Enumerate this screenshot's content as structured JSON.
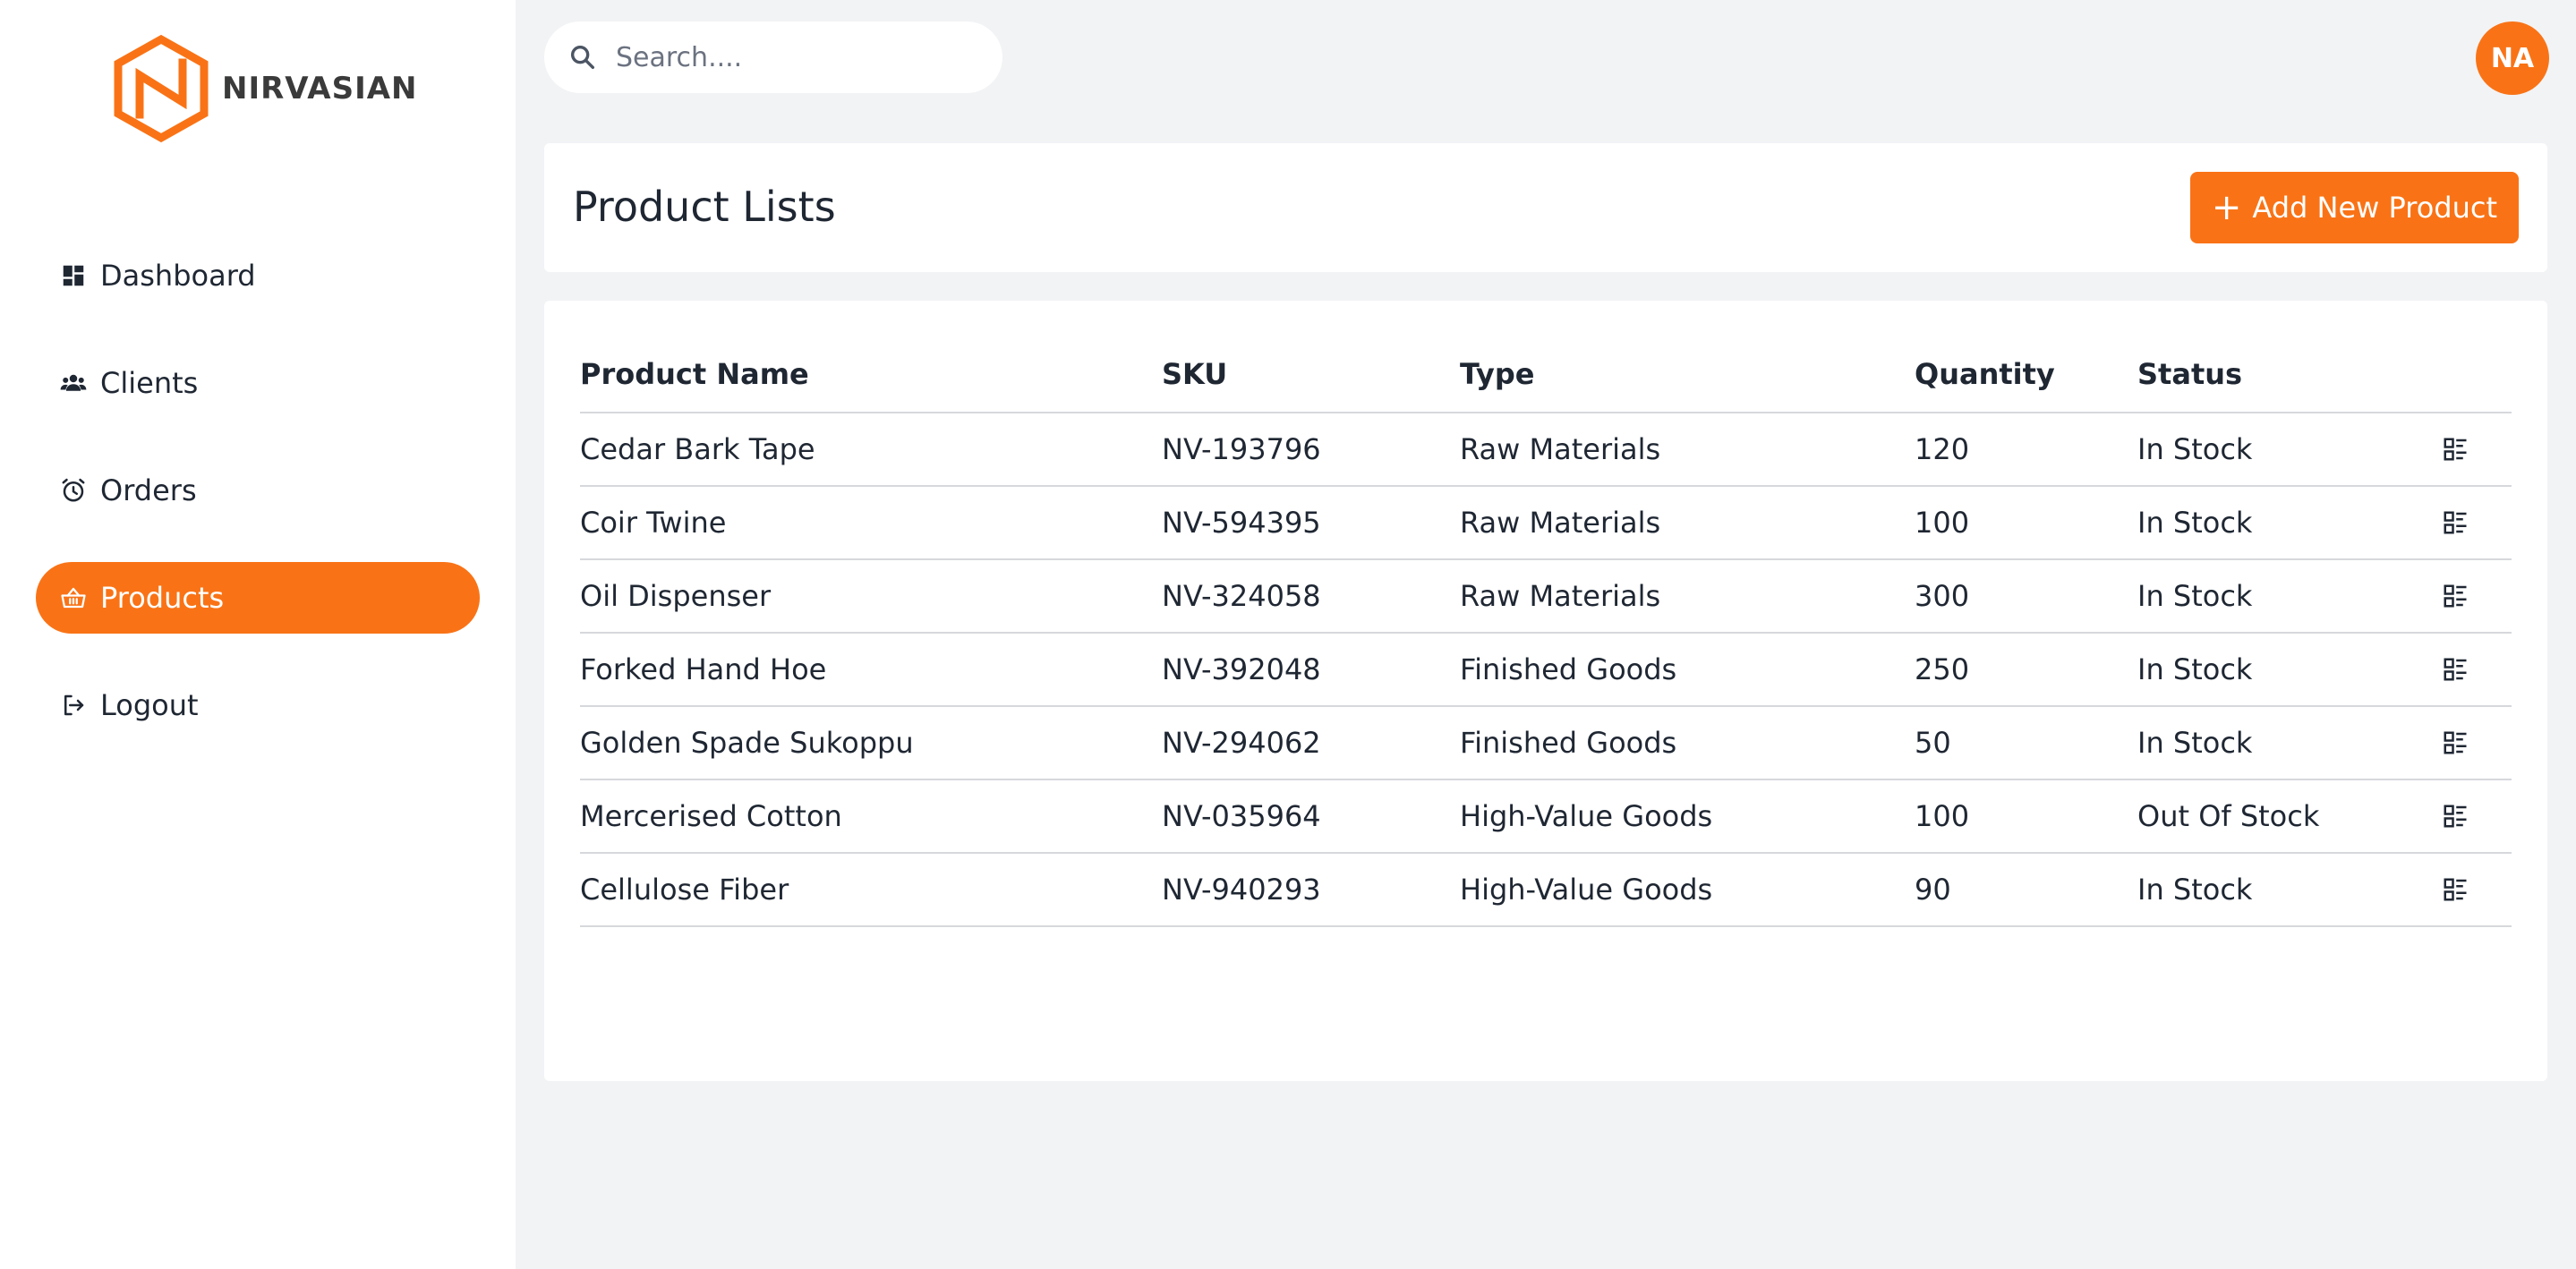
{
  "brand": {
    "name": "NIRVASIAN",
    "color": "#f97316"
  },
  "sidebar": {
    "items": [
      {
        "label": "Dashboard",
        "icon": "dashboard-icon",
        "active": false
      },
      {
        "label": "Clients",
        "icon": "users-icon",
        "active": false
      },
      {
        "label": "Orders",
        "icon": "alarm-clock-icon",
        "active": false
      },
      {
        "label": "Products",
        "icon": "basket-icon",
        "active": true
      },
      {
        "label": "Logout",
        "icon": "logout-icon",
        "active": false
      }
    ]
  },
  "search": {
    "placeholder": "Search....",
    "value": ""
  },
  "user": {
    "initials": "NA"
  },
  "header": {
    "title": "Product Lists",
    "add_button_label": "Add New Product"
  },
  "table": {
    "columns": [
      "Product Name",
      "SKU",
      "Type",
      "Quantity",
      "Status"
    ],
    "rows": [
      {
        "name": "Cedar Bark Tape",
        "sku": "NV-193796",
        "type": "Raw Materials",
        "quantity": "120",
        "status": "In Stock"
      },
      {
        "name": "Coir Twine",
        "sku": "NV-594395",
        "type": "Raw Materials",
        "quantity": "100",
        "status": "In Stock"
      },
      {
        "name": "Oil Dispenser",
        "sku": "NV-324058",
        "type": "Raw Materials",
        "quantity": "300",
        "status": "In Stock"
      },
      {
        "name": "Forked Hand Hoe",
        "sku": "NV-392048",
        "type": "Finished Goods",
        "quantity": "250",
        "status": "In Stock"
      },
      {
        "name": "Golden Spade Sukoppu",
        "sku": "NV-294062",
        "type": "Finished Goods",
        "quantity": "50",
        "status": "In Stock"
      },
      {
        "name": "Mercerised Cotton",
        "sku": "NV-035964",
        "type": "High-Value Goods",
        "quantity": "100",
        "status": "Out Of Stock"
      },
      {
        "name": "Cellulose Fiber",
        "sku": "NV-940293",
        "type": "High-Value Goods",
        "quantity": "90",
        "status": "In Stock"
      }
    ],
    "row_action_icon": "details-list-icon"
  }
}
